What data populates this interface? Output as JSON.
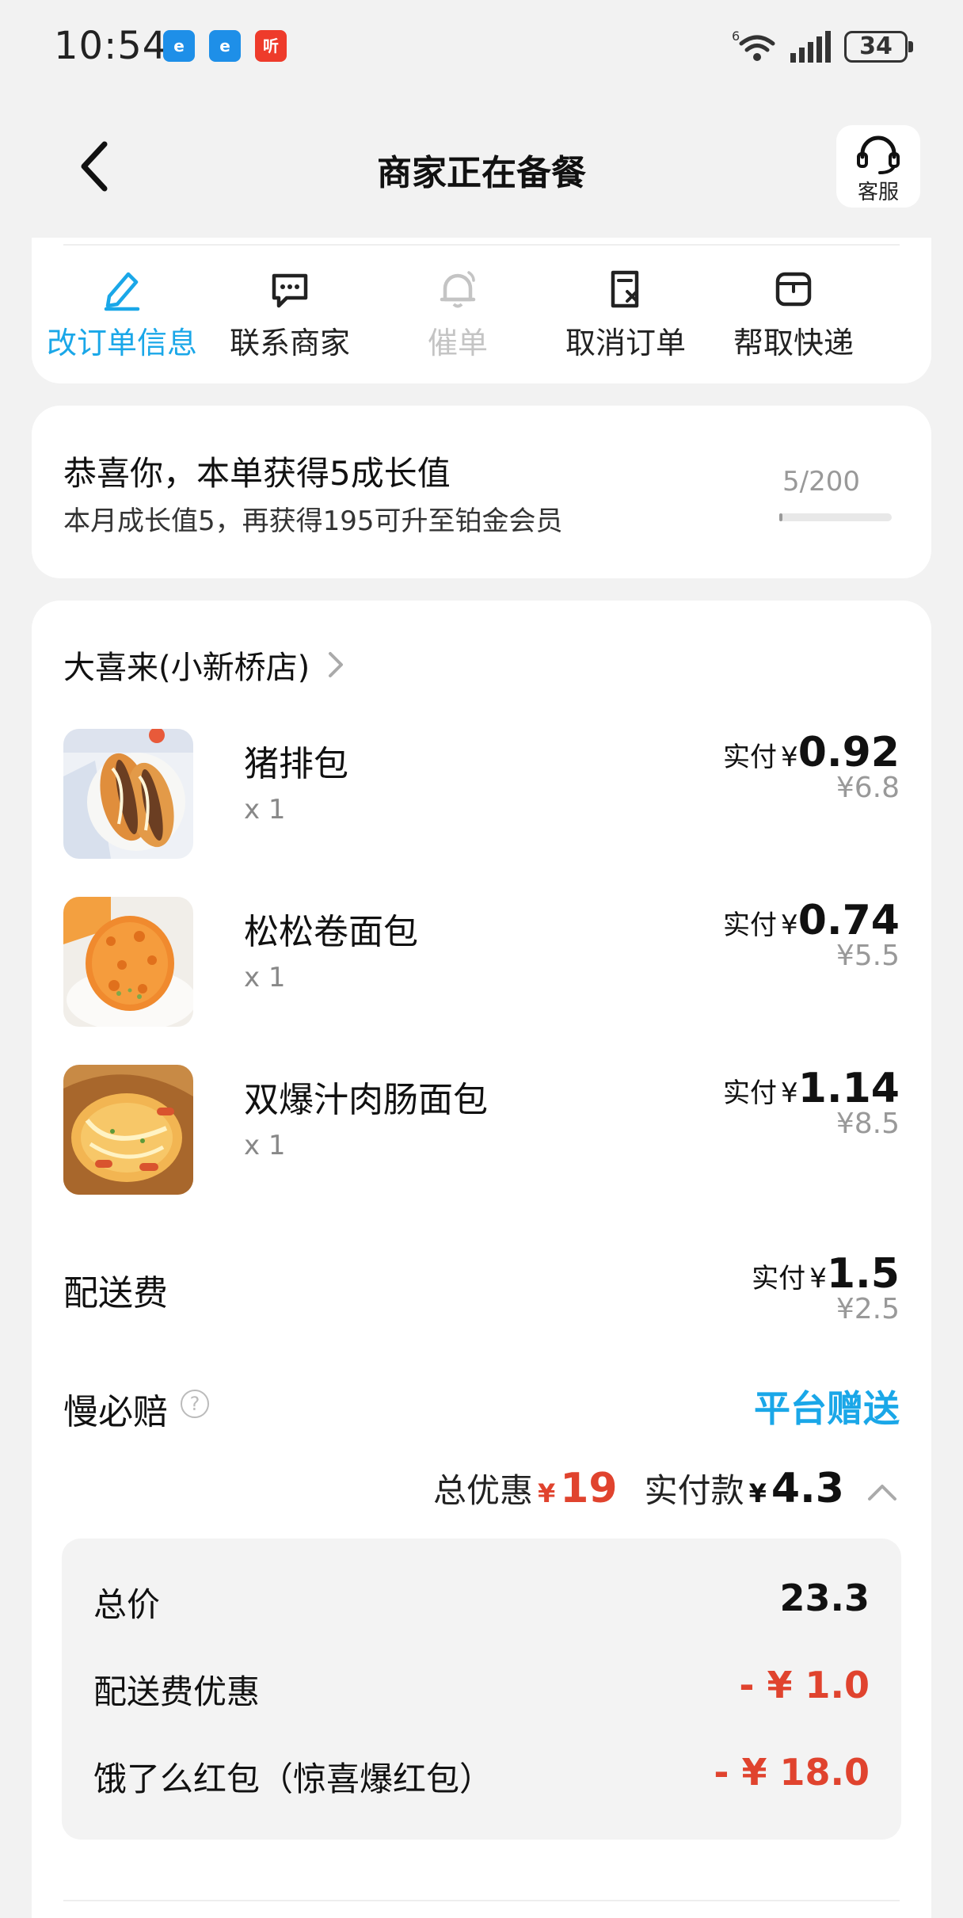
{
  "status_bar": {
    "time": "10:54",
    "apps": [
      "饿了么",
      "饿了么",
      "听"
    ],
    "network": "6",
    "battery": "34"
  },
  "nav": {
    "title": "商家正在备餐",
    "service_label": "客服"
  },
  "actions": [
    {
      "label": "改订单信息",
      "icon": "edit-icon",
      "state": "active"
    },
    {
      "label": "联系商家",
      "icon": "chat-icon",
      "state": "normal"
    },
    {
      "label": "催单",
      "icon": "bell-icon",
      "state": "disabled"
    },
    {
      "label": "取消订单",
      "icon": "cancel-doc-icon",
      "state": "normal"
    },
    {
      "label": "帮取快递",
      "icon": "package-icon",
      "state": "normal"
    }
  ],
  "growth": {
    "title": "恭喜你，本单获得5成长值",
    "subtitle": "本月成长值5，再获得195可升至铂金会员",
    "count": "5/200",
    "progress": 0.025
  },
  "order": {
    "shop_name": "大喜来(小新桥店)",
    "items": [
      {
        "name": "猪排包",
        "qty": "x 1",
        "pay_label": "实付",
        "yen": "¥",
        "amount": "0.92",
        "original": "¥6.8"
      },
      {
        "name": "松松卷面包",
        "qty": "x 1",
        "pay_label": "实付",
        "yen": "¥",
        "amount": "0.74",
        "original": "¥5.5"
      },
      {
        "name": "双爆汁肉肠面包",
        "qty": "x 1",
        "pay_label": "实付",
        "yen": "¥",
        "amount": "1.14",
        "original": "¥8.5"
      }
    ],
    "delivery_fee": {
      "label": "配送费",
      "pay_label": "实付",
      "yen": "¥",
      "amount": "1.5",
      "original": "¥2.5"
    },
    "slow_compensation": {
      "label": "慢必赔",
      "value": "平台赠送"
    },
    "summary": {
      "discount_label": "总优惠",
      "discount_yen": "¥",
      "discount_amount": "19",
      "paid_label": "实付款",
      "paid_yen": "¥",
      "paid_amount": "4.3"
    },
    "details": [
      {
        "label": "总价",
        "value": "23.3",
        "color": "#111111"
      },
      {
        "label": "配送费优惠",
        "value": "- ¥ 1.0",
        "color": "#e0432e"
      },
      {
        "label": "饿了么红包（惊喜爆红包）",
        "value": "- ¥ 18.0",
        "color": "#e0432e"
      }
    ]
  },
  "colors": {
    "accent": "#1aa7e8",
    "discount": "#e0432e"
  }
}
